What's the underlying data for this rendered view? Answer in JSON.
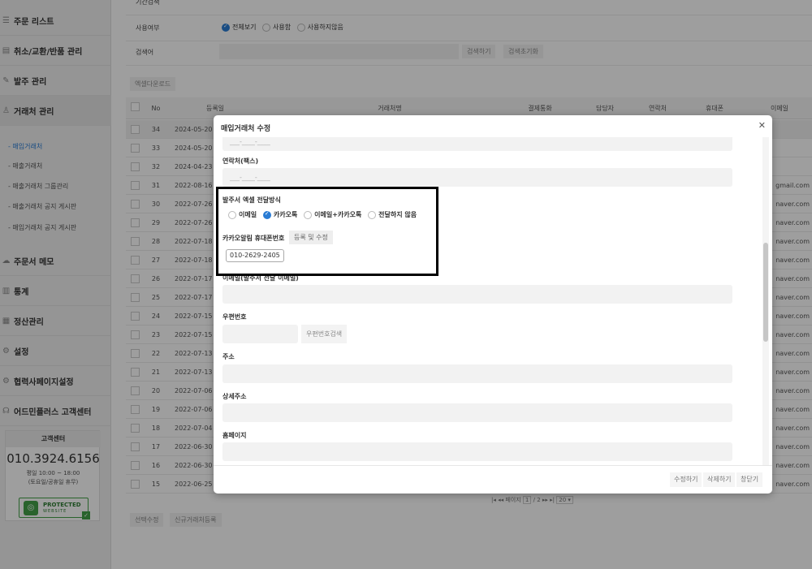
{
  "sidebar": {
    "items": [
      {
        "label": "주문 리스트",
        "icon": "list-icon"
      },
      {
        "label": "취소/교환/반품 관리",
        "icon": "return-icon"
      },
      {
        "label": "발주 관리",
        "icon": "order-icon"
      },
      {
        "label": "거래처 관리",
        "icon": "person-icon"
      },
      {
        "label": "주문서 메모",
        "icon": "memo-icon"
      },
      {
        "label": "통계",
        "icon": "chart-icon"
      },
      {
        "label": "정산관리",
        "icon": "calculator-icon"
      },
      {
        "label": "설정",
        "icon": "gear-icon"
      },
      {
        "label": "협력사페이지설정",
        "icon": "gear-icon"
      },
      {
        "label": "어드민플러스 고객센터",
        "icon": "headset-icon"
      }
    ],
    "sub_items": [
      "- 매입거래처",
      "- 매출거래처",
      "- 매출거래처 그룹관리",
      "- 매출거래처 공지 게시판",
      "- 매입거래처 공지 게시판"
    ],
    "cs": {
      "title": "고객센터",
      "phone": "010.3924.6156",
      "hours_line1": "평일 10:00 ~ 18:00",
      "hours_line2": "(토요일/공휴일 휴무)",
      "badge_line1": "PROTECTED",
      "badge_line2": "WEBSITE"
    }
  },
  "filters": {
    "period_label": "기간검색",
    "usage_label": "사용여부",
    "usage_options": [
      "전체보기",
      "사용함",
      "사용하지않음"
    ],
    "search_label": "검색어",
    "search_button": "검색하기",
    "reset_button": "검색초기화",
    "excel_button": "엑셀다운로드"
  },
  "table": {
    "headers": [
      "No",
      "등록일",
      "거래처명",
      "결제통화",
      "담당자",
      "연락처",
      "휴대폰",
      "이메일"
    ],
    "rows": [
      {
        "no": "34",
        "date": "2024-05-20",
        "email": ""
      },
      {
        "no": "33",
        "date": "2024-05-20",
        "email": ""
      },
      {
        "no": "32",
        "date": "2024-04-23",
        "email": ""
      },
      {
        "no": "31",
        "date": "2022-08-16",
        "email": "gmail.com"
      },
      {
        "no": "30",
        "date": "2022-07-26",
        "email": "naver.com"
      },
      {
        "no": "29",
        "date": "2022-07-26",
        "email": "naver.com"
      },
      {
        "no": "28",
        "date": "2022-07-18",
        "email": "naver.com"
      },
      {
        "no": "27",
        "date": "2022-07-18",
        "email": "naver.com"
      },
      {
        "no": "26",
        "date": "2022-07-17",
        "email": "naver.com"
      },
      {
        "no": "25",
        "date": "2022-07-17",
        "email": "naver.com"
      },
      {
        "no": "24",
        "date": "2022-07-15",
        "email": "naver.com"
      },
      {
        "no": "23",
        "date": "2022-07-15",
        "email": "naver.com"
      },
      {
        "no": "22",
        "date": "2022-07-13",
        "email": "naver.com"
      },
      {
        "no": "21",
        "date": "2022-07-13",
        "email": "naver.com"
      },
      {
        "no": "20",
        "date": "2022-07-06",
        "email": "naver.com"
      },
      {
        "no": "19",
        "date": "2022-07-06",
        "email": "naver.com"
      },
      {
        "no": "18",
        "date": "2022-07-04",
        "email": "naver.com"
      },
      {
        "no": "17",
        "date": "2022-06-30",
        "email": "naver.com"
      },
      {
        "no": "16",
        "date": "2022-06-30",
        "email": "naver.com"
      },
      {
        "no": "15",
        "date": "2022-06-25",
        "email": "naver.com"
      }
    ],
    "pager_text": "페이지",
    "pager_current": "1",
    "pager_total": "/ 2",
    "page_size": "20"
  },
  "bottom_buttons": [
    "선택수정",
    "신규거래처등록"
  ],
  "modal": {
    "title": "매입거래처 수정",
    "close": "✕",
    "phone_placeholder": "___-____-____",
    "fax_label": "연락처(팩스)",
    "delivery_label": "발주서 엑셀 전달방식",
    "delivery_options": [
      "이메일",
      "카카오톡",
      "이메일+카카오톡",
      "전달하지 않음"
    ],
    "kakao_label": "카카오알림 휴대폰번호",
    "kakao_button": "등록 및 수정",
    "kakao_number": "010-2629-2405",
    "email_label": "이메일(발주서 전달 이메일)",
    "zip_label": "우편번호",
    "zip_button": "우편번호검색",
    "address_label": "주소",
    "detail_label": "상세주소",
    "homepage_label": "홈페이지",
    "footer_buttons": [
      "수정하기",
      "삭제하기",
      "창닫기"
    ]
  }
}
